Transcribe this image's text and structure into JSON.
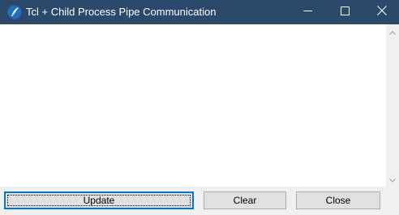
{
  "window": {
    "title": "Tcl + Child Process Pipe Communication",
    "icon": "tcl-feather-icon",
    "controls": {
      "minimize": "minimize-icon",
      "maximize": "maximize-icon",
      "close": "close-icon"
    }
  },
  "output": {
    "text": ""
  },
  "buttons": {
    "update_label": "Update",
    "clear_label": "Clear",
    "close_label": "Close"
  },
  "colors": {
    "titlebar": "#2b4a6b",
    "focus_border": "#0078d7",
    "button_face": "#e1e1e1",
    "window_bg": "#f0f0f0"
  }
}
